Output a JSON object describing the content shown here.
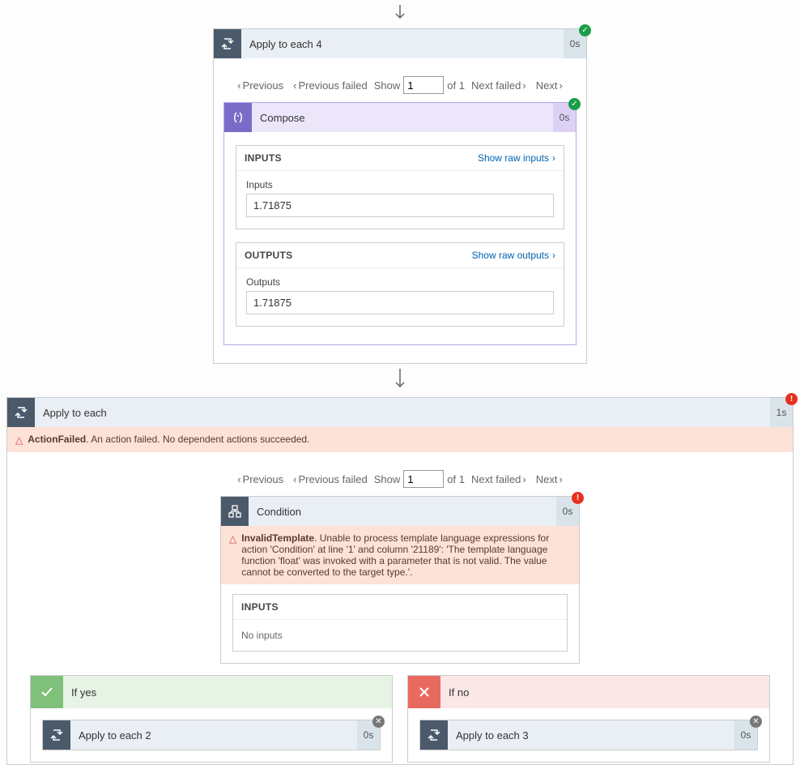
{
  "colors": {
    "loop_icon": "#4b5a6b",
    "compose_icon": "#7b6bc9",
    "success": "#1a9e47",
    "error": "#e8301f"
  },
  "pager": {
    "prev": "Previous",
    "prev_failed": "Previous failed",
    "show": "Show",
    "page": "1",
    "of_total": "of 1",
    "next_failed": "Next failed",
    "next": "Next"
  },
  "top_loop": {
    "title": "Apply to each 4",
    "duration": "0s"
  },
  "compose": {
    "title": "Compose",
    "duration": "0s",
    "inputs_label": "INPUTS",
    "inputs_link": "Show raw inputs",
    "inputs_field": "Inputs",
    "inputs_value": "1.71875",
    "outputs_label": "OUTPUTS",
    "outputs_link": "Show raw outputs",
    "outputs_field": "Outputs",
    "outputs_value": "1.71875"
  },
  "apply_each": {
    "title": "Apply to each",
    "duration": "1s",
    "err_name": "ActionFailed",
    "err_msg": ". An action failed. No dependent actions succeeded."
  },
  "condition": {
    "title": "Condition",
    "duration": "0s",
    "err_name": "InvalidTemplate",
    "err_msg": ". Unable to process template language expressions for action 'Condition' at line '1' and column '21189': 'The template language function 'float' was invoked with a parameter that is not valid. The value cannot be converted to the target type.'.",
    "inputs_label": "INPUTS",
    "noinputs": "No inputs"
  },
  "branches": {
    "yes": {
      "label": "If yes",
      "child_title": "Apply to each 2",
      "child_duration": "0s"
    },
    "no": {
      "label": "If no",
      "child_title": "Apply to each 3",
      "child_duration": "0s"
    }
  }
}
